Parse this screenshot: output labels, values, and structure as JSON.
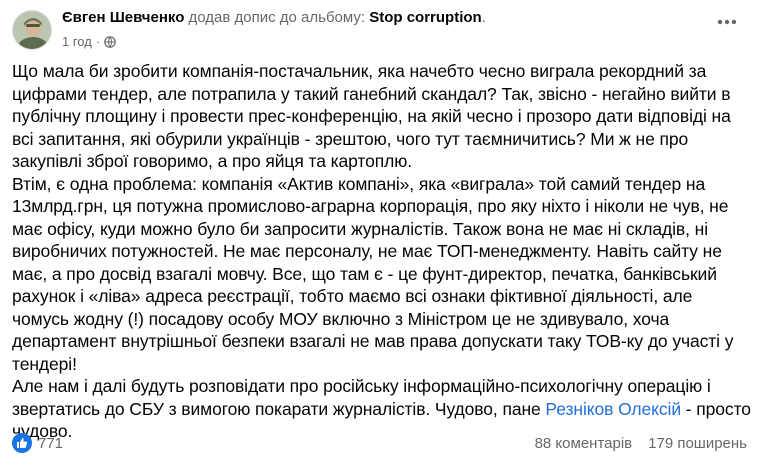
{
  "header": {
    "author": "Євген Шевченко",
    "action": "додав допис до альбому:",
    "album": "Stop corruption",
    "album_suffix": ".",
    "time": "1 год",
    "separator": "·",
    "privacy_icon": "globe-icon",
    "more_icon": "more-options-icon"
  },
  "post": {
    "paragraphs": [
      "Що мала би зробити компанія-постачальник, яка начебто чесно виграла рекордний за цифрами тендер, але потрапила у такий ганебний скандал? Так, звісно - негайно вийти в публічну площину і провести прес-конференцію, на якій чесно і прозоро дати відповіді на всі запитання, які обурили українців - зрештою, чого тут таємничитись? Ми ж не про закупівлі зброї говоримо, а про яйця та картоплю.",
      "Втім, є одна проблема: компанія «Актив компані», яка «виграла» той самий тендер на 13млрд.грн, ця потужна промислово-аграрна корпорація, про яку ніхто і ніколи не чув, не має офісу, куди можно було би запросити журналістів. Також вона не має ні складів, ні виробничих потужностей. Не має персоналу, не має ТОП-менеджменту. Навіть сайту не має, а про досвід взагалі мовчу. Все, що там є - це фунт-директор, печатка, банківський рахунок і «ліва» адреса реєстрації, тобто маємо всі ознаки фіктивної діяльності, але чомусь жодну (!) посадову особу МОУ включно з Міністром це не здивувало, хоча департамент внутрішньої безпеки взагалі не мав права допускати таку ТОВ-ку до участі у тендері!"
    ],
    "last_paragraph_before": "Але нам і далі будуть розповідати про російську інформаційно-психологічну операцію і звертатись до СБУ з вимогою покарати журналістів. Чудово, пане ",
    "tagged_person": "Резніков Олексій",
    "last_paragraph_after": " - просто чудово."
  },
  "footer": {
    "reaction_icon": "thumbs-up-icon",
    "reactions_count": "771",
    "comments": "88 коментарів",
    "shares": "179 поширень"
  },
  "colors": {
    "link": "#216fdb",
    "secondary_text": "#65676b",
    "like_blue": "#1b74e4"
  }
}
